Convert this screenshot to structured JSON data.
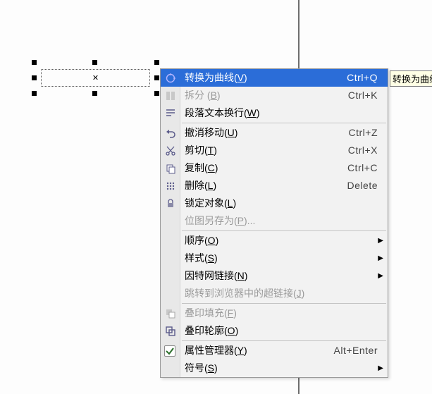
{
  "tooltip": "转换为曲线",
  "menu": [
    {
      "icon": "convert",
      "label": "转换为曲线",
      "mn": "V",
      "shortcut": "Ctrl+Q",
      "sel": true
    },
    {
      "icon": "split",
      "label": "拆分 ",
      "mn": "B",
      "shortcut": "Ctrl+K",
      "disabled": true
    },
    {
      "icon": "wrap",
      "label": "段落文本换行",
      "mn": "W"
    },
    {
      "sep": true
    },
    {
      "icon": "undo",
      "label": "撤消移动",
      "mn": "U",
      "shortcut": "Ctrl+Z"
    },
    {
      "icon": "cut",
      "label": "剪切",
      "mn": "T",
      "shortcut": "Ctrl+X"
    },
    {
      "icon": "copy",
      "label": "复制",
      "mn": "C",
      "shortcut": "Ctrl+C"
    },
    {
      "icon": "delete",
      "label": "删除",
      "mn": "L",
      "shortcut": "Delete"
    },
    {
      "icon": "lock",
      "label": "锁定对象",
      "mn": "L"
    },
    {
      "label": "位图另存为",
      "mn": "P",
      "after": "...",
      "disabled": true
    },
    {
      "sep": true
    },
    {
      "label": "顺序",
      "mn": "O",
      "sub": true
    },
    {
      "label": "样式",
      "mn": "S",
      "sub": true
    },
    {
      "label": "因特网链接",
      "mn": "N",
      "sub": true
    },
    {
      "label": "跳转到浏览器中的超链接",
      "mn": "J",
      "disabled": true
    },
    {
      "sep": true
    },
    {
      "icon": "overfill",
      "label": "叠印填充",
      "mn": "F",
      "disabled": true
    },
    {
      "icon": "overoutline",
      "label": "叠印轮廓",
      "mn": "O"
    },
    {
      "sep": true
    },
    {
      "check": true,
      "label": "属性管理器",
      "mn": "Y",
      "shortcut": "Alt+Enter"
    },
    {
      "label": "符号",
      "mn": "S",
      "sub": true
    }
  ]
}
